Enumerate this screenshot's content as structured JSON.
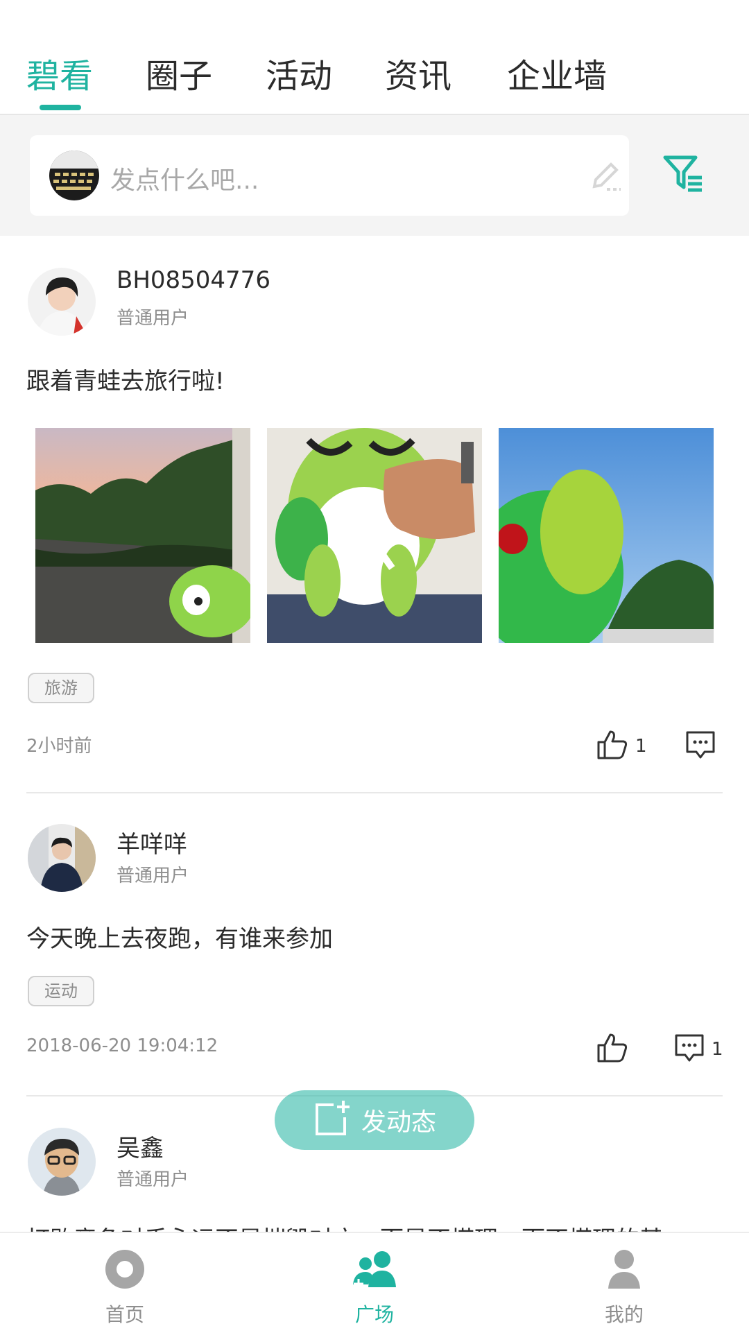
{
  "top_tabs": [
    {
      "label": "碧看",
      "active": true
    },
    {
      "label": "圈子",
      "active": false
    },
    {
      "label": "活动",
      "active": false
    },
    {
      "label": "资讯",
      "active": false
    },
    {
      "label": "企业墙",
      "active": false
    }
  ],
  "composer": {
    "placeholder": "发点什么吧..."
  },
  "posts": [
    {
      "username": "BH08504776",
      "role": "普通用户",
      "text": "跟着青蛙去旅行啦!",
      "tag": "旅游",
      "time": "2小时前",
      "likes": "1",
      "comments": ""
    },
    {
      "username": "羊咩咩",
      "role": "普通用户",
      "text": "今天晚上去夜跑，有谁来参加",
      "tag": "运动",
      "time": "2018-06-20 19:04:12",
      "likes": "",
      "comments": "1"
    },
    {
      "username": "吴鑫",
      "role": "普通用户",
      "text": "打败竞争对手永远不是摧毁对方，而是不搭理，而不搭理的基"
    }
  ],
  "fab": {
    "label": "发动态"
  },
  "bottom_nav": [
    {
      "label": "首页",
      "icon": "home-icon",
      "active": false
    },
    {
      "label": "广场",
      "icon": "community-icon",
      "active": true
    },
    {
      "label": "我的",
      "icon": "profile-icon",
      "active": false
    }
  ],
  "colors": {
    "accent": "#1fb3a0",
    "band": "#f4f4f4",
    "muted_text": "#8e8e8e"
  }
}
